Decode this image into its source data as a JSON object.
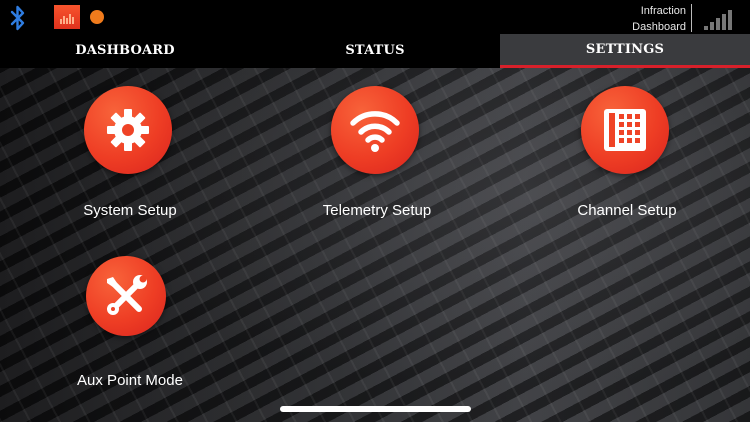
{
  "status_bar": {
    "bluetooth_icon": "bluetooth-icon",
    "app_icon": "app-badge-icon",
    "indicator_color": "#f07b1c",
    "right_label_line1": "Infraction",
    "right_label_line2": "Dashboard",
    "signal_icon": "signal-bars-icon"
  },
  "tabs": [
    {
      "label": "DASHBOARD",
      "active": false
    },
    {
      "label": "STATUS",
      "active": false
    },
    {
      "label": "SETTINGS",
      "active": true
    }
  ],
  "colors": {
    "accent": "#ee3d24",
    "active_tab_bg": "#3a3b3e",
    "active_tab_underline": "#d8202a"
  },
  "tiles": [
    {
      "label": "System Setup",
      "icon": "gear-icon"
    },
    {
      "label": "Telemetry Setup",
      "icon": "wifi-icon"
    },
    {
      "label": "Channel Setup",
      "icon": "grid-icon"
    },
    {
      "label": "Aux Point Mode",
      "icon": "tools-icon"
    }
  ]
}
